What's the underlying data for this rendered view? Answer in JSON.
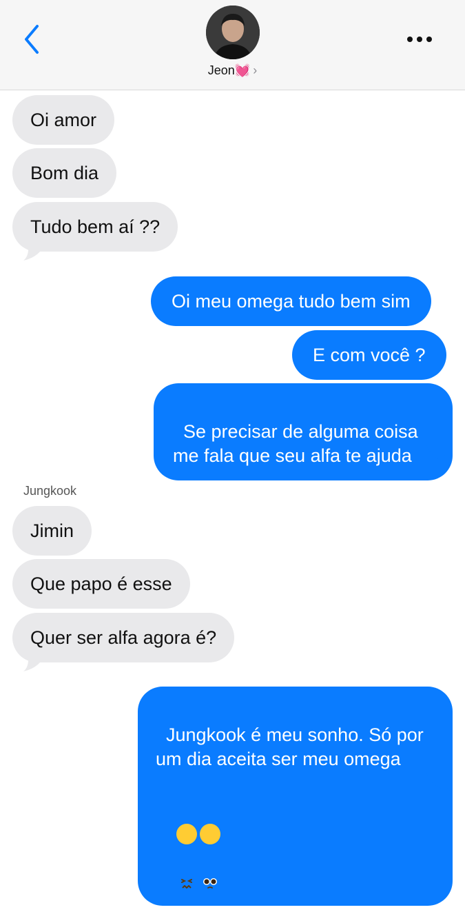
{
  "contact": {
    "name": "Jeon💓",
    "chevron": "›"
  },
  "sender_label": "Jungkook",
  "messages": [
    {
      "text": "Oi amor"
    },
    {
      "text": "Bom dia"
    },
    {
      "text": "Tudo bem aí ??"
    },
    {
      "text": "Oi meu omega tudo bem sim"
    },
    {
      "text": "E com você ?"
    },
    {
      "text": "Se precisar de alguma coisa me fala que seu alfa te ajuda"
    },
    {
      "text": "Jimin"
    },
    {
      "text": "Que papo é esse"
    },
    {
      "text": "Quer ser alfa agora é?"
    },
    {
      "text": "Jungkook é meu sonho. Só por um dia aceita ser meu omega"
    }
  ],
  "last_emojis": [
    "persevering-face-emoji",
    "pleading-face-emoji"
  ],
  "colors": {
    "outgoing": "#0a7cff",
    "incoming": "#e9e9eb",
    "accent": "#0a7cff"
  }
}
